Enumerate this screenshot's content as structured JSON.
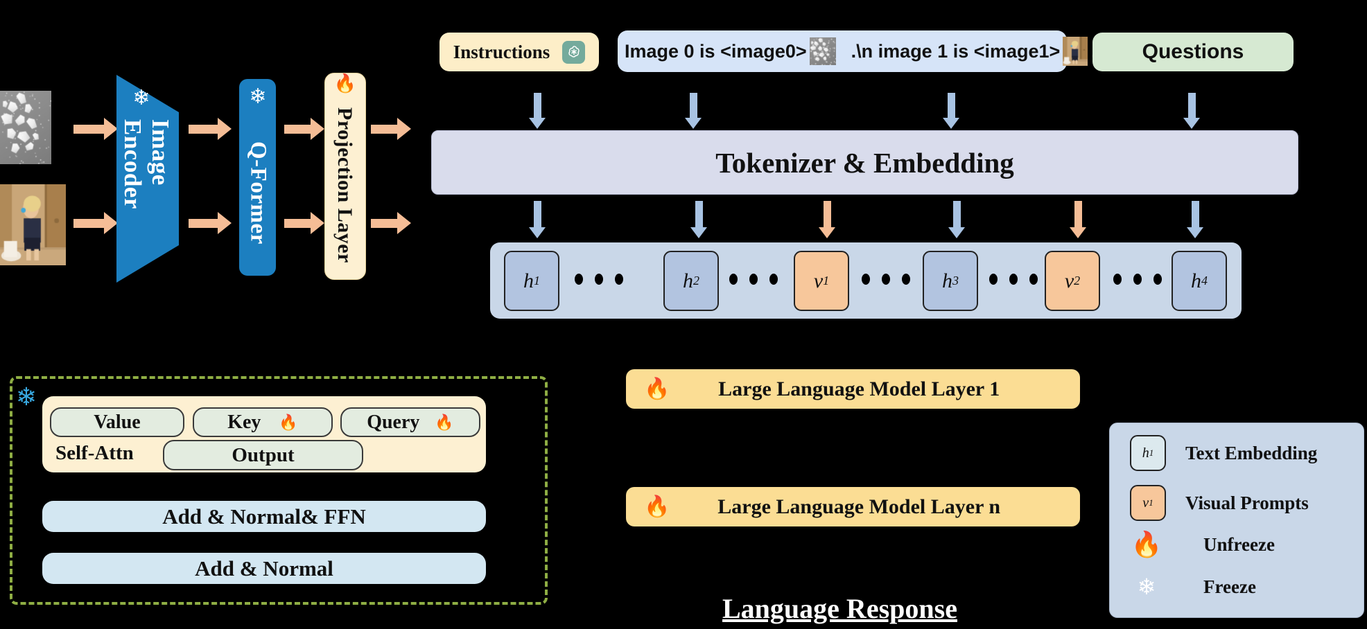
{
  "colors": {
    "background": "#000000",
    "encoder_blue": "#1c7fc0",
    "arrow_peach": "#f5bd96",
    "arrow_blue": "#a8c3e3",
    "instructions_bg": "#fdeec8",
    "prompt_bg": "#d6e4f8",
    "questions_bg": "#d6e9d2",
    "tokenizer_bg": "#d9dcec",
    "seq_bar_bg": "#c9d7e8",
    "text_token_bg": "#b2c4e0",
    "visual_token_bg": "#f7c79b",
    "llm_layer_bg": "#fbdd94",
    "attn_panel_bg": "#fdf0d2",
    "sub_pill_bg": "#e3ece0",
    "norm_bar_bg": "#d3e7f2",
    "dashed_border": "#8fae44",
    "legend_bg": "#c9d7e8",
    "projection_bg": "#fdf0d2"
  },
  "vision_branch": {
    "image_encoder": {
      "label": "Image Encoder",
      "state_icon": "snowflake-icon"
    },
    "q_former": {
      "label": "Q-Former",
      "state_icon": "snowflake-icon"
    },
    "projection_layer": {
      "label": "Projection Layer",
      "state_icon": "fire-icon"
    },
    "input_images": [
      {
        "name": "broken-ceramic-photo",
        "alt": "broken white ceramic pieces on grey background"
      },
      {
        "name": "toddler-photo",
        "alt": "toddler standing in a bathroom corner"
      }
    ]
  },
  "prompt_row": {
    "instructions": {
      "label": "Instructions",
      "icon": "openai-logo-icon"
    },
    "prompt": {
      "segment_1": "Image 0 is <image0>",
      "thumb_1": "broken-ceramic-thumb",
      "segment_2": ".\\n image 1 is <image1>",
      "thumb_2": "toddler-thumb",
      "segment_3": "."
    },
    "questions": {
      "label": "Questions"
    }
  },
  "tokenizer": {
    "label": "Tokenizer & Embedding"
  },
  "sequence": {
    "tokens": [
      {
        "label": "h",
        "sub": "1",
        "type": "text"
      },
      {
        "label": "h",
        "sub": "2",
        "type": "text"
      },
      {
        "label": "v",
        "sub": "1",
        "type": "visual"
      },
      {
        "label": "h",
        "sub": "3",
        "type": "text"
      },
      {
        "label": "v",
        "sub": "2",
        "type": "visual"
      },
      {
        "label": "h",
        "sub": "4",
        "type": "text"
      }
    ]
  },
  "self_attention_panel": {
    "state_icon": "snowflake-icon",
    "self_attn_label": "Self-Attn",
    "value": {
      "label": "Value",
      "icon": null
    },
    "key": {
      "label": "Key",
      "icon": "fire-icon"
    },
    "query": {
      "label": "Query",
      "icon": "fire-icon"
    },
    "output": {
      "label": "Output"
    },
    "bars": [
      {
        "label": "Add & Normal& FFN"
      },
      {
        "label": "Add & Normal"
      }
    ]
  },
  "llm_layers": [
    {
      "label": "Large Language Model Layer 1",
      "state_icon": "fire-icon"
    },
    {
      "label": "Large Language Model Layer n",
      "state_icon": "fire-icon"
    }
  ],
  "output": {
    "language_response": "Language Response"
  },
  "legend": {
    "rows": [
      {
        "swatch": "h",
        "sub": "1",
        "type": "text",
        "label": "Text Embedding"
      },
      {
        "swatch": "v",
        "sub": "1",
        "type": "visual",
        "label": "Visual Prompts"
      },
      {
        "swatch": "fire-icon",
        "label": "Unfreeze"
      },
      {
        "swatch": "snowflake-icon",
        "label": "Freeze"
      }
    ]
  }
}
